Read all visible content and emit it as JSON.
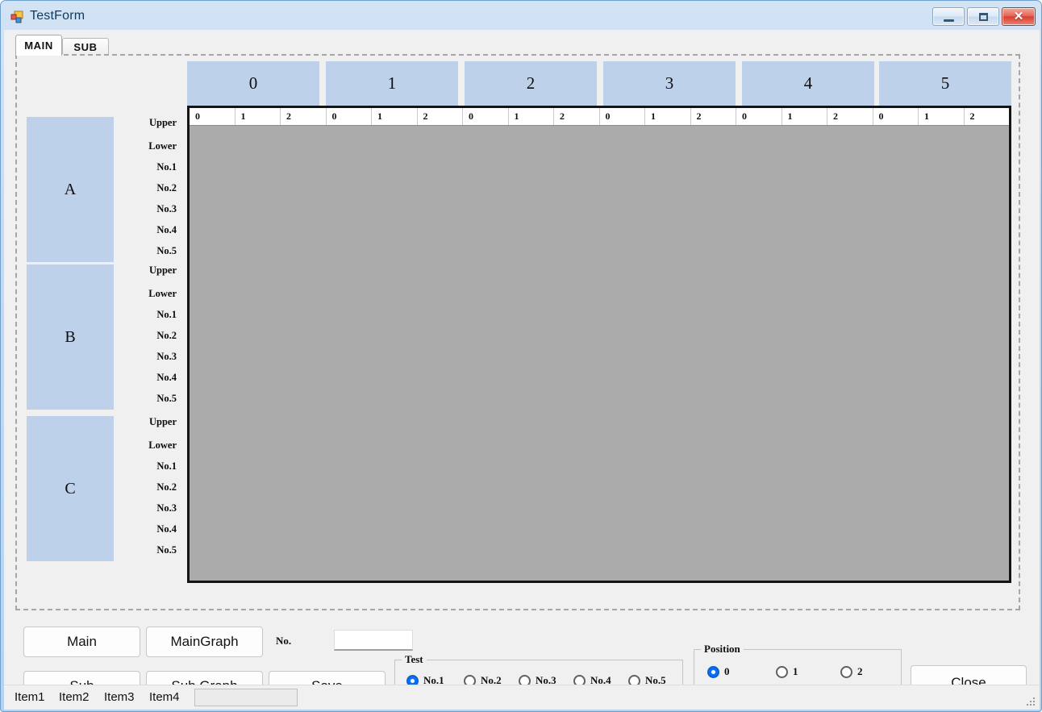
{
  "window": {
    "title": "TestForm",
    "icon": "winforms-app-icon",
    "controls": {
      "minimize": "minimize-button",
      "maximize": "maximize-button",
      "close": "close-button",
      "close_glyph": "✕"
    }
  },
  "tabs": [
    {
      "label": "MAIN",
      "active": true
    },
    {
      "label": "SUB",
      "active": false
    }
  ],
  "grid": {
    "column_headers": [
      "0",
      "1",
      "2",
      "3",
      "4",
      "5"
    ],
    "sub_columns": [
      "0",
      "1",
      "2"
    ],
    "row_groups": [
      {
        "name": "A",
        "labels": [
          "Upper",
          "Lower",
          "No.1",
          "No.2",
          "No.3",
          "No.4",
          "No.5"
        ]
      },
      {
        "name": "B",
        "labels": [
          "Upper",
          "Lower",
          "No.1",
          "No.2",
          "No.3",
          "No.4",
          "No.5"
        ]
      },
      {
        "name": "C",
        "labels": [
          "Upper",
          "Lower",
          "No.1",
          "No.2",
          "No.3",
          "No.4",
          "No.5"
        ]
      }
    ]
  },
  "buttons": {
    "main": "Main",
    "main_graph": "MainGraph",
    "sub": "Sub",
    "sub_graph": "Sub Graph",
    "save": "Save",
    "close": "Close"
  },
  "no_field": {
    "label": "No.",
    "value": "",
    "placeholder": ""
  },
  "test_group": {
    "title": "Test",
    "options": [
      {
        "label": "No.1",
        "checked": true
      },
      {
        "label": "No.2",
        "checked": false
      },
      {
        "label": "No.3",
        "checked": false
      },
      {
        "label": "No.4",
        "checked": false
      },
      {
        "label": "No.5",
        "checked": false
      }
    ]
  },
  "position_group": {
    "title": "Position",
    "options": [
      {
        "label": "0",
        "checked": true
      },
      {
        "label": "1",
        "checked": false
      },
      {
        "label": "2",
        "checked": false
      }
    ]
  },
  "statusbar": {
    "items": [
      "Item1",
      "Item2",
      "Item3",
      "Item4"
    ],
    "panel_text": ""
  },
  "colors": {
    "header_blue": "#bdd2ea",
    "grid_body_gray": "#ababab",
    "accent_radio": "#0d6efd",
    "form_face": "#f0f0f0",
    "title_text": "#11385c"
  }
}
